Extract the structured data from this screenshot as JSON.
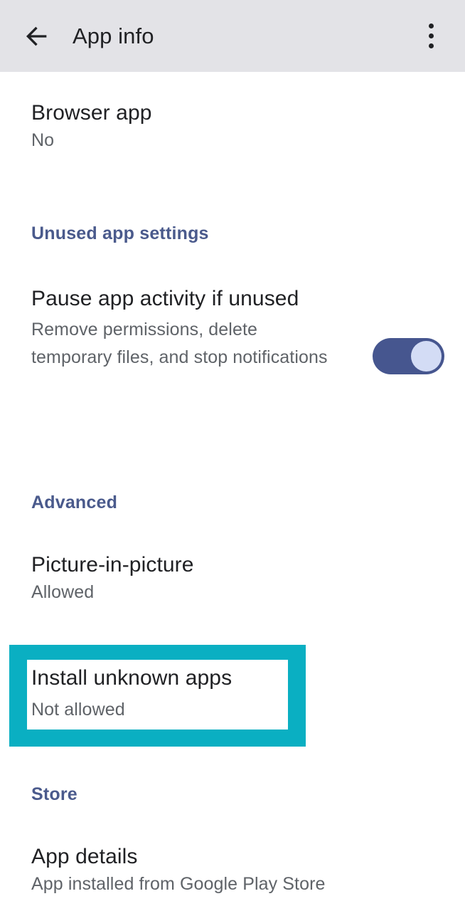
{
  "appbar": {
    "back_icon": "arrow-left-icon",
    "title": "App info",
    "overflow_icon": "more-vertical-icon"
  },
  "colors": {
    "appbar_bg": "#e3e3e7",
    "page_bg": "#ffffff",
    "title_text": "#202124",
    "subtitle_text": "#5f6368",
    "section_header": "#4a5a8c",
    "toggle_track_on": "#46568f",
    "toggle_thumb_on": "#d3dcf5",
    "highlight": "#0aafc2"
  },
  "rows": {
    "browser_app": {
      "title": "Browser app",
      "subtitle": "No"
    },
    "pause_app_activity": {
      "title": "Pause app activity if unused",
      "subtitle": "Remove permissions, delete temporary files, and stop notifications",
      "toggle_state": "on"
    },
    "picture_in_picture": {
      "title": "Picture-in-picture",
      "subtitle": "Allowed"
    },
    "install_unknown_apps": {
      "title": "Install unknown apps",
      "subtitle": "Not allowed",
      "highlighted": true
    },
    "app_details": {
      "title": "App details",
      "subtitle": "App installed from Google Play Store"
    }
  },
  "sections": {
    "unused_app_settings": "Unused app settings",
    "advanced": "Advanced",
    "store": "Store"
  }
}
